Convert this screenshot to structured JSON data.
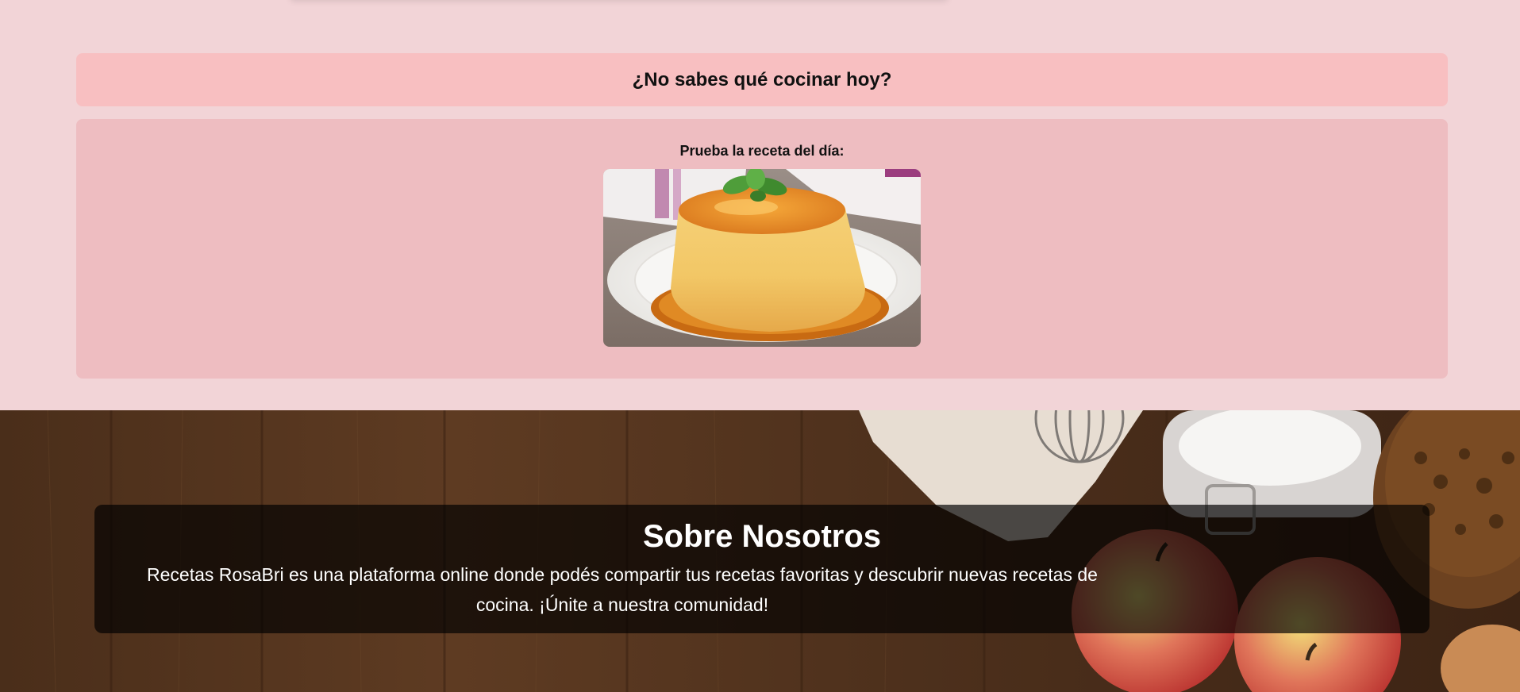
{
  "colors": {
    "page_bg": "#f2d4d7",
    "banner_bg": "#f8bfc1",
    "daily_bg": "#eebdc1",
    "about_overlay": "rgba(0,0,0,0.68)",
    "wood": "#5a3a22"
  },
  "banner": {
    "title": "¿No sabes qué cocinar hoy?"
  },
  "daily_recipe": {
    "label": "Prueba la receta del día:",
    "image_icon": "flan-dessert-photo"
  },
  "about": {
    "title": "Sobre Nosotros",
    "text": "Recetas RosaBri es una plataforma online donde podés compartir tus recetas favoritas y descubrir nuevas recetas de cocina. ¡Únite a nuestra comunidad!",
    "background_icon": "kitchen-table-photo"
  }
}
